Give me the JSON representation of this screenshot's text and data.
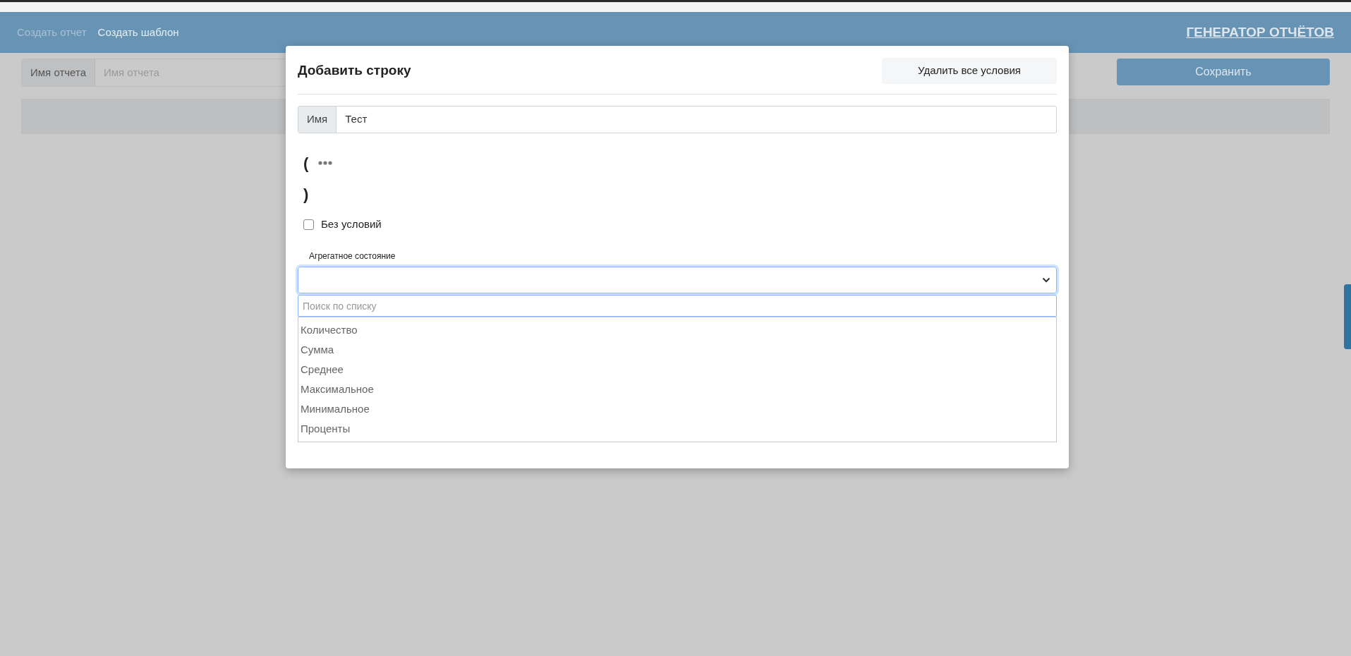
{
  "header": {
    "nav": [
      {
        "label": "Создать отчет",
        "selected": false
      },
      {
        "label": "Создать шаблон",
        "selected": true
      }
    ],
    "title": "ГЕНЕРАТОР ОТЧЁТОВ"
  },
  "report_name": {
    "label": "Имя отчета",
    "placeholder": "Имя отчета"
  },
  "save_button": "Сохранить",
  "modal": {
    "title": "Добавить строку",
    "delete_button": "Удалить все условия",
    "name": {
      "label": "Имя",
      "value": "Тест"
    },
    "open_paren": "(",
    "close_paren": ")",
    "no_conditions": {
      "label": "Без условий",
      "checked": false
    },
    "aggregate": {
      "label": "Агрегатное состояние",
      "expanded": true,
      "search_placeholder": "Поиск по списку",
      "options": [
        "Количество",
        "Сумма",
        "Среднее",
        "Максимальное",
        "Минимальное",
        "Проценты"
      ]
    }
  }
}
